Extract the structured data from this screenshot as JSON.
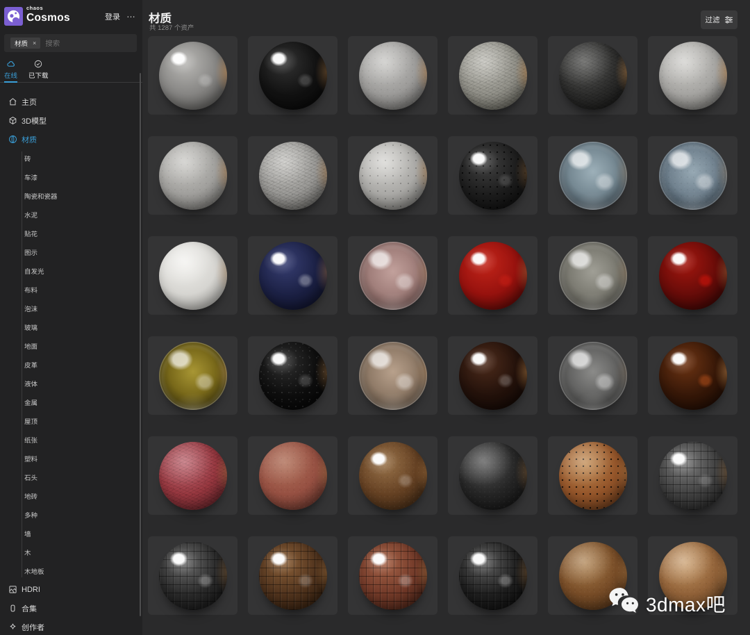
{
  "sidebar": {
    "brand": {
      "small": "chaos",
      "big": "Cosmos"
    },
    "login_label": "登录",
    "menu_dots": "...",
    "search": {
      "tag": "材质",
      "tag_close": "×",
      "placeholder": "搜索"
    },
    "tabs": [
      {
        "label": "在线",
        "icon": "cloud-icon",
        "active": true
      },
      {
        "label": "已下载",
        "icon": "check-circle-icon",
        "active": false
      }
    ],
    "items": [
      {
        "label": "主页",
        "icon": "home-icon"
      },
      {
        "label": "3D模型",
        "icon": "cube-icon"
      },
      {
        "label": "材质",
        "icon": "sphere-icon",
        "active": true
      }
    ],
    "material_categories": [
      "砖",
      "车漆",
      "陶瓷和瓷器",
      "水泥",
      "贴花",
      "图示",
      "自发光",
      "布料",
      "泡沫",
      "玻璃",
      "地面",
      "皮革",
      "液体",
      "金属",
      "屋顶",
      "纸张",
      "塑料",
      "石头",
      "地砖",
      "多种",
      "墙",
      "木",
      "木地板"
    ],
    "bottom_items": [
      {
        "label": "HDRI",
        "icon": "image-icon"
      },
      {
        "label": "合集",
        "icon": "collection-icon"
      },
      {
        "label": "创作者",
        "icon": "sparkle-icon"
      }
    ]
  },
  "header": {
    "title": "材质",
    "asset_count": "共 1287 个资产",
    "filter_label": "过滤",
    "filter_icon": "sliders-icon"
  },
  "colors": {
    "accent_blue": "#3a9fd8",
    "logo_purple": "#7b5fd2",
    "sidebar_bg": "#222223",
    "main_bg": "#2a2a2b",
    "card_bg": "#343435"
  },
  "materials": [
    {
      "name": "polished-light-gray",
      "finish": "glossy",
      "texture": "none",
      "base": "#868583",
      "light": "#b9b8b5",
      "dark": "#3f3e3c",
      "s2": 0.22,
      "rim": 0.45
    },
    {
      "name": "glossy-black",
      "finish": "glossy",
      "texture": "none",
      "base": "#121212",
      "light": "#323232",
      "dark": "#040404",
      "s2": 0.18,
      "rim": 0.3
    },
    {
      "name": "matte-light-gray",
      "finish": "matte",
      "texture": "rough",
      "base": "#9c9b99",
      "light": "#c5c4c1",
      "dark": "#504f4d",
      "s1": 0.3,
      "rim": 0.38
    },
    {
      "name": "gray-crackle",
      "finish": "matte",
      "texture": "crackle",
      "base": "#93928a",
      "light": "#bcbbb3",
      "dark": "#48473f",
      "s1": 0.28,
      "rim": 0.4
    },
    {
      "name": "black-crackle",
      "finish": "matte",
      "texture": "crackle",
      "base": "#2e2e2d",
      "light": "#5d5d5b",
      "dark": "#0f0f0e",
      "s1": 0.2,
      "rim": 0.38
    },
    {
      "name": "light-gray-stucco",
      "finish": "matte",
      "texture": "rough",
      "base": "#a5a4a1",
      "light": "#cccbc7",
      "dark": "#555451",
      "s1": 0.34,
      "rim": 0.42
    },
    {
      "name": "gray-plaster",
      "finish": "matte",
      "texture": "rough",
      "base": "#a09f9c",
      "light": "#c8c7c3",
      "dark": "#53524f",
      "s1": 0.3,
      "rim": 0.35
    },
    {
      "name": "gray-crinkle",
      "finish": "matte",
      "texture": "crackle",
      "base": "#9b9a97",
      "light": "#c3c2be",
      "dark": "#4f4e4b",
      "s1": 0.28,
      "rim": 0.32
    },
    {
      "name": "gray-perforated",
      "finish": "matte",
      "texture": "dots",
      "base": "#aaa9a6",
      "light": "#d0cfcb",
      "dark": "#585754",
      "s1": 0.36,
      "rim": 0.32,
      "dotA": 0.25
    },
    {
      "name": "black-perforated",
      "finish": "glossy",
      "texture": "dots-big",
      "base": "#1d1d1d",
      "light": "#424242",
      "dark": "#070707",
      "s2": 0.14,
      "rim": 0.25,
      "dotA": 0.7
    },
    {
      "name": "clear-glass",
      "finish": "glass",
      "texture": "none",
      "base": "#768993",
      "light": "#9db0b9",
      "dark": "#333f48",
      "rim": 0.16
    },
    {
      "name": "frosted-glass",
      "finish": "glass",
      "texture": "rough",
      "base": "#71828f",
      "light": "#97a9b4",
      "dark": "#32404b",
      "rim": 0.16
    },
    {
      "name": "matte-white",
      "finish": "matte",
      "texture": "none",
      "base": "#d6d5d1",
      "light": "#efeeea",
      "dark": "#83827e",
      "s1": 0.45,
      "rim": 0.22
    },
    {
      "name": "navy-gloss",
      "finish": "glossy",
      "texture": "none",
      "base": "#1c2145",
      "light": "#373e72",
      "dark": "#090b1c",
      "s2": 0.32,
      "rim": 0.3
    },
    {
      "name": "rose-glass",
      "finish": "glass",
      "texture": "none",
      "base": "#a17f7b",
      "light": "#c2a19c",
      "dark": "#5b413e",
      "rim": 0.2
    },
    {
      "name": "red-gloss",
      "finish": "glossy",
      "texture": "none",
      "base": "#97120e",
      "light": "#c32419",
      "dark": "#380503",
      "s2": 0.5,
      "rim": 0.3,
      "patch": "205,32,22"
    },
    {
      "name": "smoke-glass",
      "finish": "glass",
      "texture": "none",
      "base": "#7d7c73",
      "light": "#a09f96",
      "dark": "#44433d",
      "rim": 0.16
    },
    {
      "name": "dark-red-gloss",
      "finish": "glossy",
      "texture": "none",
      "base": "#680c09",
      "light": "#a4160e",
      "dark": "#220302",
      "s2": 0.65,
      "rim": 0.3,
      "patch": "200,20,10"
    },
    {
      "name": "amber-glass",
      "finish": "glass",
      "texture": "none",
      "base": "#79691a",
      "light": "#a89634",
      "dark": "#352e0a",
      "rim": 0.25,
      "patch": "205,180,40"
    },
    {
      "name": "black-sparkle",
      "finish": "glossy",
      "texture": "sparkle",
      "base": "#0e0e0e",
      "light": "#2d2d2d",
      "dark": "#020202",
      "s2": 0.18,
      "rim": 0.3
    },
    {
      "name": "taupe-glass",
      "finish": "glass",
      "texture": "none",
      "base": "#917c69",
      "light": "#b8a18c",
      "dark": "#4f4235",
      "rim": 0.22
    },
    {
      "name": "espresso-gloss",
      "finish": "glossy",
      "texture": "none",
      "base": "#24120b",
      "light": "#4d2b1b",
      "dark": "#0a0402",
      "s2": 0.22,
      "rim": 0.38
    },
    {
      "name": "pale-glass",
      "finish": "glass",
      "texture": "none",
      "base": "#646463",
      "light": "#8b8b89",
      "dark": "#343433",
      "rim": 0.1
    },
    {
      "name": "dark-amber-glass",
      "finish": "glossy",
      "texture": "none",
      "base": "#371808",
      "light": "#6e3413",
      "dark": "#120601",
      "s2": 0.6,
      "rim": 0.42,
      "patch": "170,75,25"
    },
    {
      "name": "red-leather",
      "finish": "matte",
      "texture": "crackle",
      "base": "#983840",
      "light": "#c16a74",
      "dark": "#491a1e",
      "s1": 0.22,
      "rim": 0.3
    },
    {
      "name": "terracotta-leather",
      "finish": "matte",
      "texture": "rough",
      "base": "#965042",
      "light": "#b07059",
      "dark": "#49251e",
      "s1": 0.2,
      "rim": 0.28
    },
    {
      "name": "brown-leather",
      "finish": "glossy",
      "texture": "rough",
      "base": "#654123",
      "light": "#99734a",
      "dark": "#2e1d0d",
      "s2": 0.22,
      "rim": 0.3
    },
    {
      "name": "black-leather",
      "finish": "matte",
      "texture": "rough",
      "base": "#252525",
      "light": "#525252",
      "dark": "#0c0c0c",
      "s1": 0.28,
      "rim": 0.25
    },
    {
      "name": "perforated-tan",
      "finish": "matte",
      "texture": "dots-big",
      "base": "#94552a",
      "light": "#c08a51",
      "dark": "#482812",
      "s1": 0.28,
      "rim": 0.3,
      "dotA": 0.75
    },
    {
      "name": "gray-croc",
      "finish": "glossy",
      "texture": "croc",
      "base": "#404040",
      "light": "#7d7d7d",
      "dark": "#161616",
      "s2": 0.18,
      "rim": 0.25
    },
    {
      "name": "black-croc-tiles",
      "finish": "glossy",
      "texture": "croc",
      "base": "#2a2a2a",
      "light": "#6b6b6b",
      "dark": "#0c0c0c",
      "s2": 0.28,
      "rim": 0.25
    },
    {
      "name": "brown-croc-wood",
      "finish": "glossy",
      "texture": "croc",
      "base": "#50331d",
      "light": "#8a5f38",
      "dark": "#221407",
      "s2": 0.22,
      "rim": 0.3
    },
    {
      "name": "redbrown-croc",
      "finish": "glossy",
      "texture": "croc",
      "base": "#713928",
      "light": "#a66348",
      "dark": "#33180f",
      "s2": 0.28,
      "rim": 0.3
    },
    {
      "name": "black-croc",
      "finish": "glossy",
      "texture": "croc",
      "base": "#1f1f1f",
      "light": "#5e5e5e",
      "dark": "#060606",
      "s2": 0.28,
      "rim": 0.25
    },
    {
      "name": "brown-pebbled",
      "finish": "matte",
      "texture": "rough",
      "base": "#774c27",
      "light": "#ab7e4b",
      "dark": "#39230f",
      "s1": 0.32,
      "rim": 0.3
    },
    {
      "name": "tan-pebbled",
      "finish": "matte",
      "texture": "rough",
      "base": "#906138",
      "light": "#c69763",
      "dark": "#472e16",
      "s1": 0.35,
      "rim": 0.3
    }
  ],
  "watermark": {
    "text": "3dmax吧",
    "icon": "wechat-icon"
  }
}
